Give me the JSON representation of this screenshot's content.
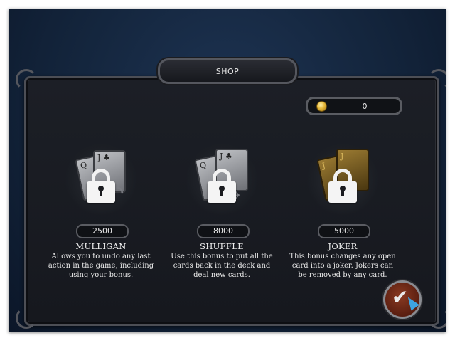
{
  "shop": {
    "title": "SHOP",
    "coins": "0"
  },
  "items": [
    {
      "name": "MULLIGAN",
      "price": "2500",
      "description": "Allows you to undo any last action in the game, including using your bonus."
    },
    {
      "name": "SHUFFLE",
      "price": "8000",
      "description": "Use this bonus to put all the cards back in the deck and deal new cards."
    },
    {
      "name": "JOKER",
      "price": "5000",
      "description": "This bonus changes any open card into a joker. Jokers can be removed by any card."
    }
  ],
  "confirm_icon": "checkmark-icon"
}
